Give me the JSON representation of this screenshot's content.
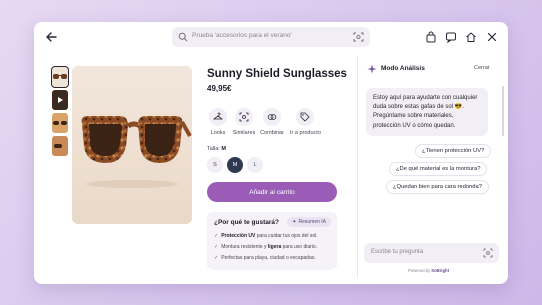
{
  "search": {
    "placeholder": "Prueba 'accesorios para el verano'"
  },
  "product": {
    "title": "Sunny Shield Sunglasses",
    "price": "49,95€",
    "actions": [
      {
        "label": "Looks",
        "icon": "hanger-icon"
      },
      {
        "label": "Similares",
        "icon": "scan-icon"
      },
      {
        "label": "Combinar",
        "icon": "rings-icon"
      },
      {
        "label": "Ir a producto",
        "icon": "tag-icon"
      }
    ],
    "size_label": "Talla:",
    "size_selected": "M",
    "sizes": [
      "S",
      "M",
      "L"
    ],
    "cart_button": "Añadir al carrito",
    "why": {
      "heading": "¿Por qué te gustará?",
      "badge": "Resumen IA",
      "items": [
        {
          "bold": "Protección UV",
          "rest": " para cuidar tus ojos del sol."
        },
        {
          "pre": "Montura resistente y ",
          "bold": "ligera",
          "rest": " para uso diario."
        },
        {
          "rest": "Perfectas para playa, ciudad o escapadas."
        }
      ]
    }
  },
  "chat": {
    "title": "Modo Análisis",
    "close_label": "Cerrar",
    "bot_message": "Estoy aquí para ayudarte con cualquier duda sobre estas gafas de sol 😎. Pregúntame sobre materiales, protección UV o cómo quedan.",
    "suggestions": [
      "¿Tienen protección UV?",
      "¿De qué material es la montura?",
      "¿Quedan bien para cara redonda?"
    ],
    "input_placeholder": "Escribe tu pregunta",
    "powered_prefix": "Powered by",
    "powered_brand": "SoBright"
  },
  "colors": {
    "accent": "#9b5cb8",
    "selected_size": "#2f3952",
    "background": "#d9c9ee"
  }
}
